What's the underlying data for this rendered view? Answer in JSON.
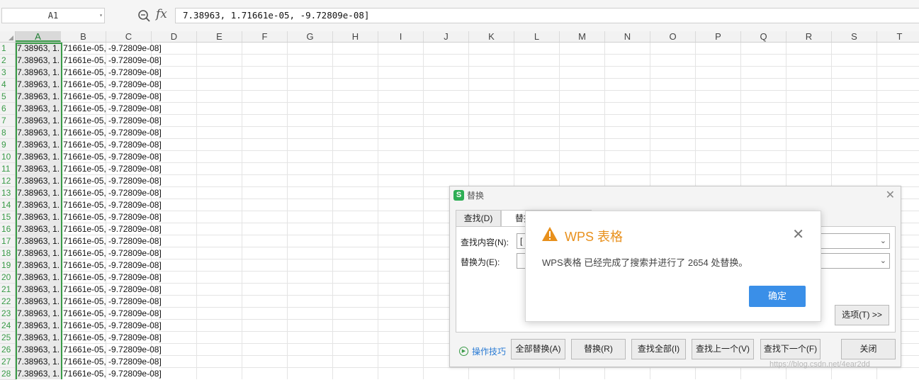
{
  "formula_bar": {
    "name_box": "A1",
    "name_box_dropdown_icon": "chevron-down-icon",
    "zoom_icon": "magnifier-icon",
    "fx_label": "fx",
    "formula": "7.38963, 1.71661e-05, -9.72809e-08]"
  },
  "sheet": {
    "columns": [
      "A",
      "B",
      "C",
      "D",
      "E",
      "F",
      "G",
      "H",
      "I",
      "J",
      "K",
      "L",
      "M",
      "N",
      "O",
      "P",
      "Q",
      "R",
      "S",
      "T"
    ],
    "selected_column": "A",
    "rows": [
      "1",
      "2",
      "3",
      "4",
      "5",
      "6",
      "7",
      "8",
      "9",
      "10",
      "11",
      "12",
      "13",
      "14",
      "15",
      "16",
      "17",
      "18",
      "19",
      "20",
      "21",
      "22",
      "23",
      "24",
      "25",
      "26",
      "27",
      "28"
    ],
    "cell_a": "7.38963, 1.",
    "cell_b": "71661e-05, -9.72809e-08]"
  },
  "replace_dialog": {
    "title": "替换",
    "logo_letter": "S",
    "tabs": [
      "查找(D)",
      "替换"
    ],
    "find_label": "查找内容(N):",
    "find_value": "[",
    "replace_label": "替换为(E):",
    "replace_value": "",
    "options_button": "选项(T) >>",
    "tips_link": "操作技巧",
    "buttons": {
      "replace_all": "全部替换(A)",
      "replace": "替换(R)",
      "find_all": "查找全部(I)",
      "find_prev": "查找上一个(V)",
      "find_next": "查找下一个(F)",
      "close": "关闭"
    }
  },
  "alert": {
    "title": "WPS 表格",
    "message": "WPS表格 已经完成了搜索并进行了 2654 处替换。",
    "ok": "确定",
    "accent_color": "#e8901c",
    "button_color": "#3a8fe8"
  },
  "watermark": "https://blog.csdn.net/4ear2dd"
}
